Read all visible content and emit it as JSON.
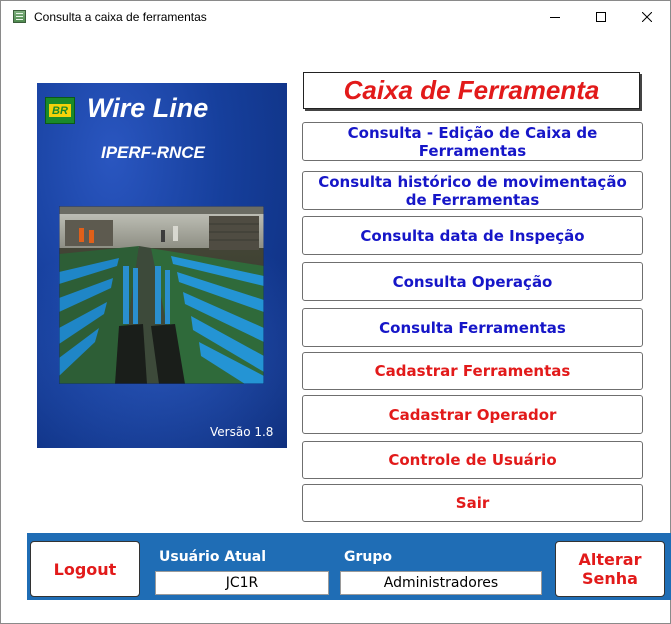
{
  "window": {
    "title": "Consulta a caixa de ferramentas"
  },
  "brand": {
    "logo_text": "BR",
    "app_name": "Wire Line",
    "unit": "IPERF-RNCE",
    "version": "Versão 1.8"
  },
  "menu": {
    "header": "Caixa de Ferramenta",
    "items": [
      {
        "label": "Consulta - Edição de Caixa de Ferramentas",
        "color": "#1616c8"
      },
      {
        "label": "Consulta histórico de movimentação de Ferramentas",
        "color": "#1616c8"
      },
      {
        "label": "Consulta data de Inspeção",
        "color": "#1616c8"
      },
      {
        "label": "Consulta Operação",
        "color": "#1616c8"
      },
      {
        "label": "Consulta Ferramentas",
        "color": "#1616c8"
      },
      {
        "label": "Cadastrar Ferramentas",
        "color": "#e21a1a"
      },
      {
        "label": "Cadastrar Operador",
        "color": "#e21a1a"
      },
      {
        "label": "Controle de Usuário",
        "color": "#e21a1a"
      },
      {
        "label": "Sair",
        "color": "#e21a1a"
      }
    ]
  },
  "footer": {
    "logout_label": "Logout",
    "user_label": "Usuário Atual",
    "user_value": "JC1R",
    "group_label": "Grupo",
    "group_value": "Administradores",
    "change_password_label": "Alterar\nSenha"
  },
  "colors": {
    "accent_blue": "#1f6db5",
    "link_blue": "#1616c8",
    "alert_red": "#e21a1a"
  }
}
